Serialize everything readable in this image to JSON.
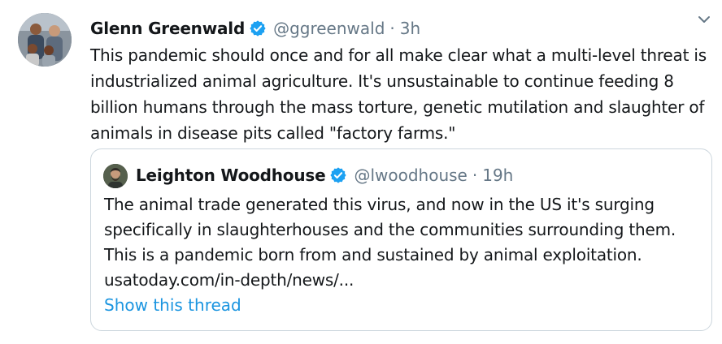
{
  "tweet": {
    "author": {
      "display_name": "Glenn Greenwald",
      "handle": "@ggreenwald",
      "verified": true,
      "avatar": "profile-photo-family"
    },
    "separator": "·",
    "time": "3h",
    "text": "This pandemic should once and for all make clear what a multi-level threat is industrialized animal agriculture. It's unsustainable to continue feeding 8 billion humans through the mass torture, genetic mutilation and slaughter of animals in disease pits called \"factory farms.\"",
    "menu_icon": "chevron-down-icon"
  },
  "quoted_tweet": {
    "author": {
      "display_name": "Leighton Woodhouse",
      "handle": "@lwoodhouse",
      "verified": true,
      "avatar": "profile-photo-man"
    },
    "separator": "·",
    "time": "19h",
    "text": "The animal trade generated this virus, and now in the US it's surging specifically in slaughterhouses and the communities surrounding them. This is a pandemic born from and sustained by animal exploitation. usatoday.com/in-depth/news/...",
    "show_thread": "Show this thread"
  },
  "colors": {
    "verified_blue": "#1da1f2",
    "link_blue": "#1b95e0",
    "secondary_text": "#657786",
    "border": "#ccd6dd"
  }
}
